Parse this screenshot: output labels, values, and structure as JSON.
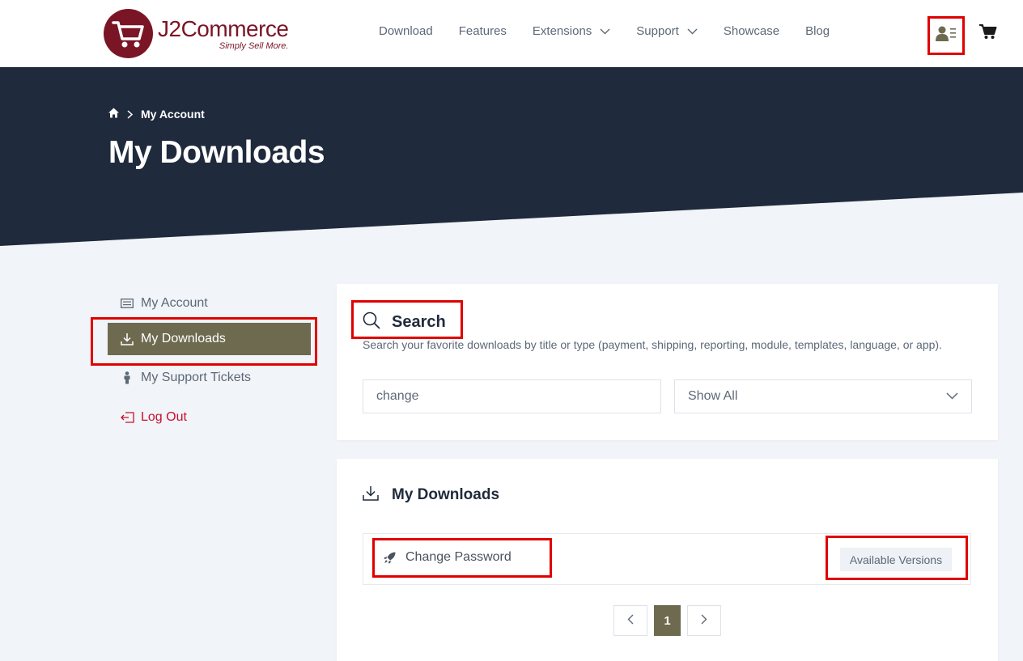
{
  "header": {
    "logo": {
      "name": "J2Commerce",
      "tagline": "Simply Sell More."
    },
    "nav": [
      {
        "label": "Download",
        "dropdown": false
      },
      {
        "label": "Features",
        "dropdown": false
      },
      {
        "label": "Extensions",
        "dropdown": true
      },
      {
        "label": "Support",
        "dropdown": true
      },
      {
        "label": "Showcase",
        "dropdown": false
      },
      {
        "label": "Blog",
        "dropdown": false
      }
    ],
    "icons": {
      "account": "user-list-icon",
      "cart": "cart-icon"
    }
  },
  "hero": {
    "breadcrumb": {
      "home_icon": "home-icon",
      "current": "My Account"
    },
    "title": "My Downloads"
  },
  "sidebar": {
    "items": [
      {
        "label": "My Account",
        "icon": "list-icon"
      },
      {
        "label": "My Downloads",
        "icon": "download-icon",
        "active": true
      },
      {
        "label": "My Support Tickets",
        "icon": "person-icon"
      },
      {
        "label": "Log Out",
        "icon": "logout-icon"
      }
    ]
  },
  "search": {
    "title": "Search",
    "description": "Search your favorite downloads by title or type (payment, shipping, reporting, module, templates, language, or app).",
    "query": "change",
    "type_selected": "Show All"
  },
  "downloads": {
    "title": "My Downloads",
    "items": [
      {
        "name": "Change Password",
        "icon": "rocket-icon",
        "action": "Available Versions"
      }
    ]
  },
  "pagination": {
    "current": "1"
  },
  "colors": {
    "brand": "#7a1525",
    "hero_bg": "#1f2a3c",
    "accent": "#6d6a4f",
    "highlight": "#e00000",
    "logout": "#c8102e"
  }
}
